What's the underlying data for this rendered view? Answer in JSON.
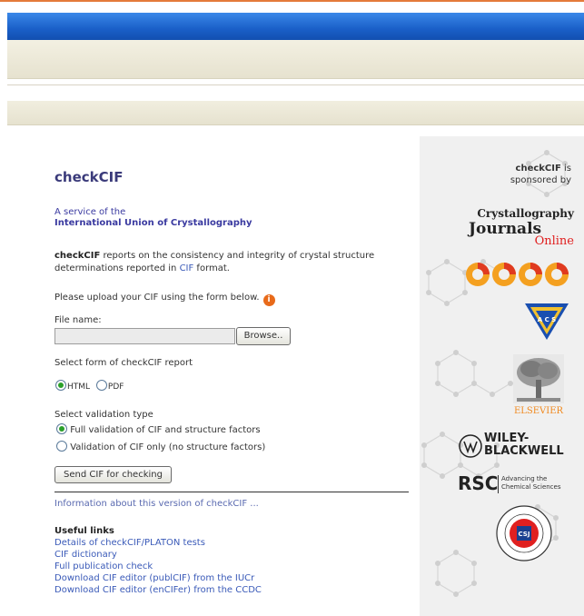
{
  "header": {
    "colors": {
      "blue_band": "#1a5fc8",
      "beige_band": "#ebe7d6",
      "top_rule": "#e47a3a"
    }
  },
  "main": {
    "title": "checkCIF",
    "service_line1": "A service of the",
    "service_line2": "International Union of Crystallography",
    "description_bold": "checkCIF",
    "description_text": " reports on the consistency and integrity of crystal structure determinations reported in ",
    "description_link": "CIF",
    "description_end": " format.",
    "upload_prompt": "Please upload your CIF using the form below.",
    "help_icon_glyph": "i",
    "file_label": "File name:",
    "file_value": "",
    "browse_label": "Browse..",
    "report_label": "Select form of checkCIF report",
    "report_options": [
      {
        "label": "HTML",
        "checked": true
      },
      {
        "label": "PDF",
        "checked": false
      }
    ],
    "validation_label": "Select validation type",
    "validation_options": [
      {
        "label": "Full validation of CIF and structure factors",
        "checked": true
      },
      {
        "label": "Validation of CIF only (no structure factors)",
        "checked": false
      }
    ],
    "send_label": "Send CIF for checking",
    "info_link": "Information about this version of checkCIF ...",
    "useful_title": "Useful links",
    "useful_links": [
      "Details of checkCIF/PLATON tests",
      "CIF dictionary",
      "Full publication check",
      "Download CIF editor (publCIF) from the IUCr",
      "Download CIF editor (enCIFer) from the CCDC"
    ]
  },
  "sidebar": {
    "sponsor_bold": "checkCIF",
    "sponsor_is": " is",
    "sponsor_line2": "sponsored by",
    "cj_line1": "Crystallography",
    "cj_line2": "Journals",
    "cj_line3": "Online",
    "elsevier": "ELSEVIER",
    "wiley_line1": "WILEY-",
    "wiley_line2": "BLACKWELL",
    "rsc_big": "RSC",
    "rsc_small1": "Advancing the",
    "rsc_small2": "Chemical Sciences",
    "acs_text": "A C S",
    "csj_text": "CSJ"
  }
}
